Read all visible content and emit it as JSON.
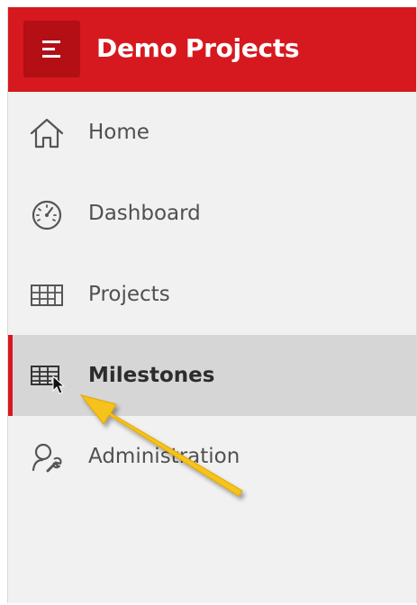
{
  "header": {
    "title": "Demo Projects",
    "menu_icon": "hamburger-icon",
    "brand_color": "#d6191f"
  },
  "nav": {
    "items": [
      {
        "label": "Home",
        "icon": "home-icon"
      },
      {
        "label": "Dashboard",
        "icon": "speedometer-icon"
      },
      {
        "label": "Projects",
        "icon": "grid-icon"
      },
      {
        "label": "Milestones",
        "icon": "table-list-icon",
        "active": true
      },
      {
        "label": "Administration",
        "icon": "user-wrench-icon"
      }
    ]
  },
  "annotation": {
    "arrow_color": "#f6c21b",
    "cursor": "mouse-pointer-icon"
  }
}
